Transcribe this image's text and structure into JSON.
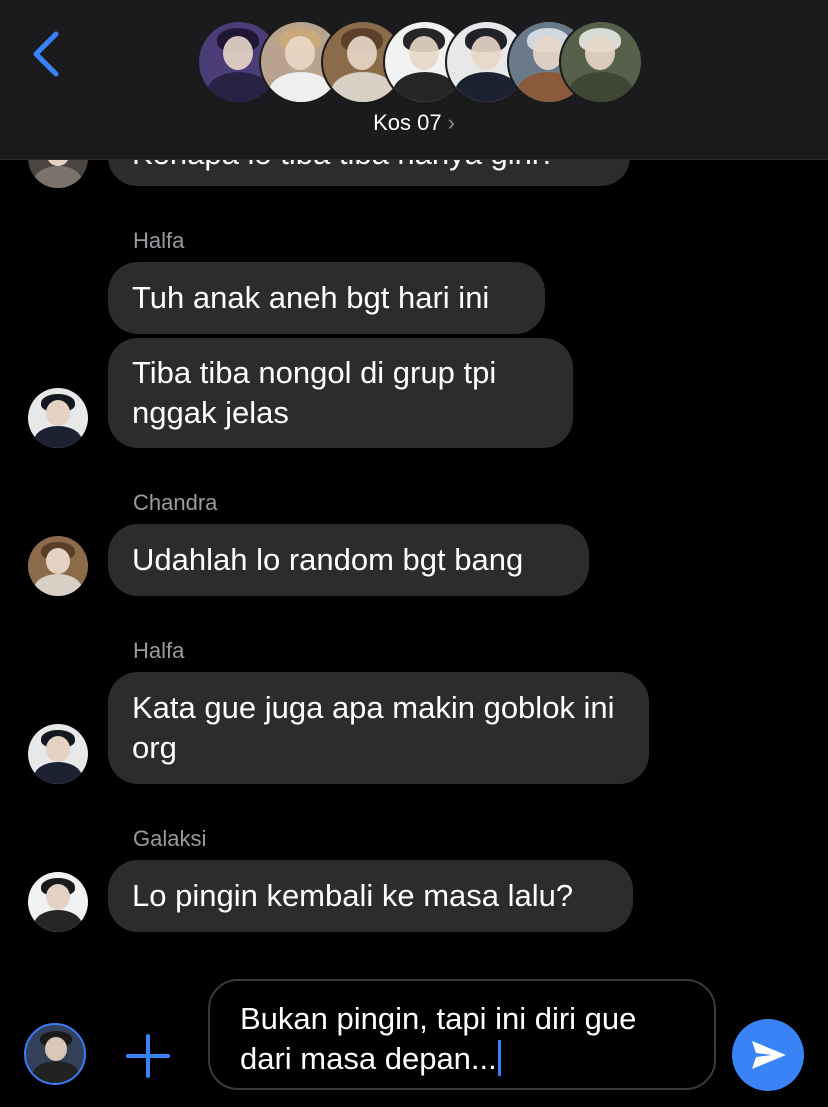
{
  "header": {
    "group_name": "Kos 07",
    "chevron": "›",
    "back_icon": "chevron-left-icon",
    "member_avatar_count": 7
  },
  "messages": [
    {
      "sender": "",
      "text": "Kenapa lo tiba tiba hanya gini?",
      "partial": true
    },
    {
      "sender": "Halfa",
      "text": "Tuh anak aneh bgt hari ini"
    },
    {
      "sender": "",
      "text": "Tiba tiba nongol di grup tpi nggak jelas"
    },
    {
      "sender": "Chandra",
      "text": "Udahlah lo random bgt bang"
    },
    {
      "sender": "Halfa",
      "text": "Kata gue juga apa makin goblok ini org"
    },
    {
      "sender": "Galaksi",
      "text": "Lo pingin kembali ke masa lalu?"
    }
  ],
  "composer": {
    "input_value": "Bukan pingin, tapi ini diri gue dari masa depan...",
    "add_icon": "plus-icon",
    "send_icon": "send-icon"
  },
  "colors": {
    "accent": "#3a83f7",
    "bubble": "#2c2c2e",
    "header_bg": "#1b1b1d",
    "sender_label": "#9a9aa0"
  }
}
